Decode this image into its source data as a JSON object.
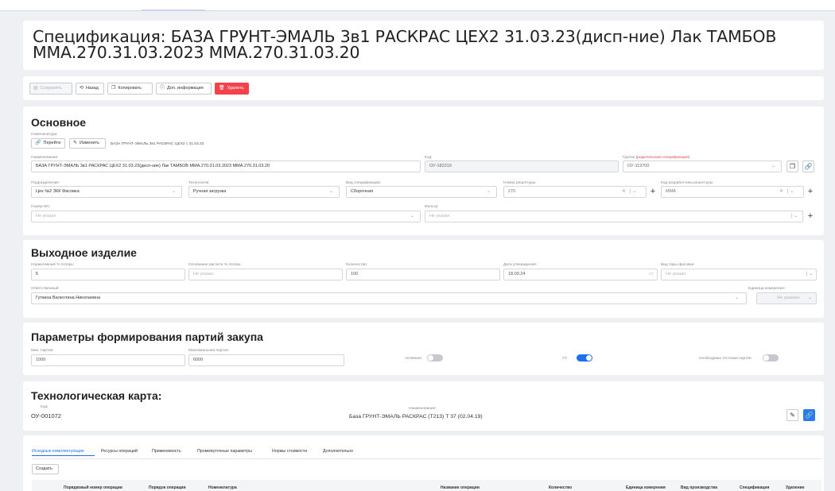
{
  "page_title": "Спецификация: БАЗА ГРУНТ-ЭМАЛЬ 3в1 РАСКРАС ЦЕХ2 31.03.23(дисп-ние) Лак ТАМБОВ ММА.270.31.03.2023 ММА.270.31.03.20",
  "toolbar": {
    "save": "Сохранить",
    "back": "Назад",
    "copy": "Копировать",
    "info": "Доп. информация",
    "delete": "Удалить"
  },
  "main": {
    "title": "Основное",
    "nomenclature_label": "Номенклатура:",
    "goto_btn": "Перейти",
    "change_btn": "Изменить",
    "nomenclature_value": "БАЗА ГРУНТ-ЭМАЛЬ 3в1 РАСКРАС ЦЕХ2 с 31.03.23",
    "name_label": "Наименование:",
    "name_value": "БАЗА ГРУНТ-ЭМАЛЬ 3в1 РАСКРАС ЦЕХ2 31.03.23(дисп-ние) Лак ТАМБОВ ММА.270.31.03.2023  ММА.270.31.03.20",
    "code_label": "Код:",
    "code_value": "ОУ-182319",
    "group_label": "Группа",
    "group_hint": "(родительская спецификация)",
    "group_value": "ОУ-119700",
    "dept_label": "Подразделение:",
    "dept_value": "Цех №2 ЗКК Фасовка",
    "tech_label": "Технология:",
    "tech_value": "Ручная загрузка",
    "spec_type_label": "Вид спецификации:",
    "spec_type_value": "Сборочная",
    "recipe_num_label": "Номер рецептуры:",
    "recipe_num_value": "270",
    "recipe_dev_label": "Код разработчика рецептуры:",
    "recipe_dev_value": "ММА",
    "fa_label": "Номер ФА:",
    "fa_value": "Не указан",
    "filter_label": "Фильтр:",
    "filter_value": "Не указан"
  },
  "output": {
    "title": "Выходное изделие",
    "loss_label": "Нормативный % потерь:",
    "loss_value": "5",
    "loss_basis_label": "Основание расчета % потерь:",
    "loss_basis_value": "Не указан",
    "qty_label": "Количество:",
    "qty_value": "100",
    "date_label": "Дата утверждения:",
    "date_value": "18.09.24",
    "pack_label": "Вид тары фасовки:",
    "pack_value": "Не указан",
    "resp_label": "Ответственный:",
    "resp_value": "Гуткина Валентина Николаевна",
    "unit_label": "Единица измерения:",
    "unit_value": "Не указано"
  },
  "batch": {
    "title": "Параметры формирования партий закупа",
    "min_label": "Мин. партия:",
    "min_value": "1000",
    "max_label": "Максимальная партия:",
    "max_value": "6000",
    "active_label": "Активная:",
    "active_on": false,
    "ut_label": "УТ:",
    "ut_on": true,
    "test_label": "Необходима тестовая партия:",
    "test_on": false
  },
  "techmap": {
    "title": "Технологическая карта:",
    "code_label": "Код:",
    "code_value": "ОУ-001072",
    "name_label": "Наименование:",
    "name_value": "База ГРУНТ-ЭМАЛЬ РАСКРАС (Т213) Т 37 (02.04.19)"
  },
  "tabs": [
    "Исходные комплектующие",
    "Ресурсы операций",
    "Применимость",
    "Промежуточные параметры",
    "Нормы стоимости",
    "Дополнительно"
  ],
  "create_btn": "Создать",
  "table_headers": [
    "Порядковый номер операции",
    "Порядок операции",
    "Номенклатура",
    "Название операции",
    "Количество",
    "Единица измерения",
    "Вид производства",
    "Спецификация",
    "Удаление"
  ],
  "colors": {
    "accent": "#1d6ff0",
    "danger": "#f2434c"
  }
}
